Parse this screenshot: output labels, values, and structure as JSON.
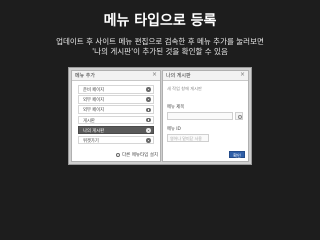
{
  "header": {
    "title": "메뉴 타입으로 등록",
    "subtitle_line1": "업데이트 후 사이트 메뉴 편집으로 검속한 후 메뉴 추가를 눌러보면",
    "subtitle_line2": "'나의 게시판'이 추가된 것을 확인할 수 있음"
  },
  "left_panel": {
    "title": "메뉴 추가",
    "close_icon": "×",
    "items": [
      {
        "label": "준비 페이지",
        "selected": false
      },
      {
        "label": "외부 페이지",
        "selected": false
      },
      {
        "label": "외부 페이지",
        "selected": false
      },
      {
        "label": "게시판",
        "selected": false
      },
      {
        "label": "나의 게시판",
        "selected": true
      },
      {
        "label": "위젯가기",
        "selected": false
      }
    ],
    "add_other_label": "다른 메뉴타입 설치"
  },
  "right_panel": {
    "title": "나의 게시판",
    "close_icon": "×",
    "hint": "새 작업 창에 게시판",
    "field1_label": "메뉴 제목",
    "field2_label": "메뉴 ID",
    "field2_placeholder": "영어나 밑미닫 사용",
    "confirm_label": "확인"
  },
  "colors": {
    "background": "#1d1d1d",
    "selected_item": "#5a5a5a",
    "confirm_button": "#2f5fa8"
  }
}
